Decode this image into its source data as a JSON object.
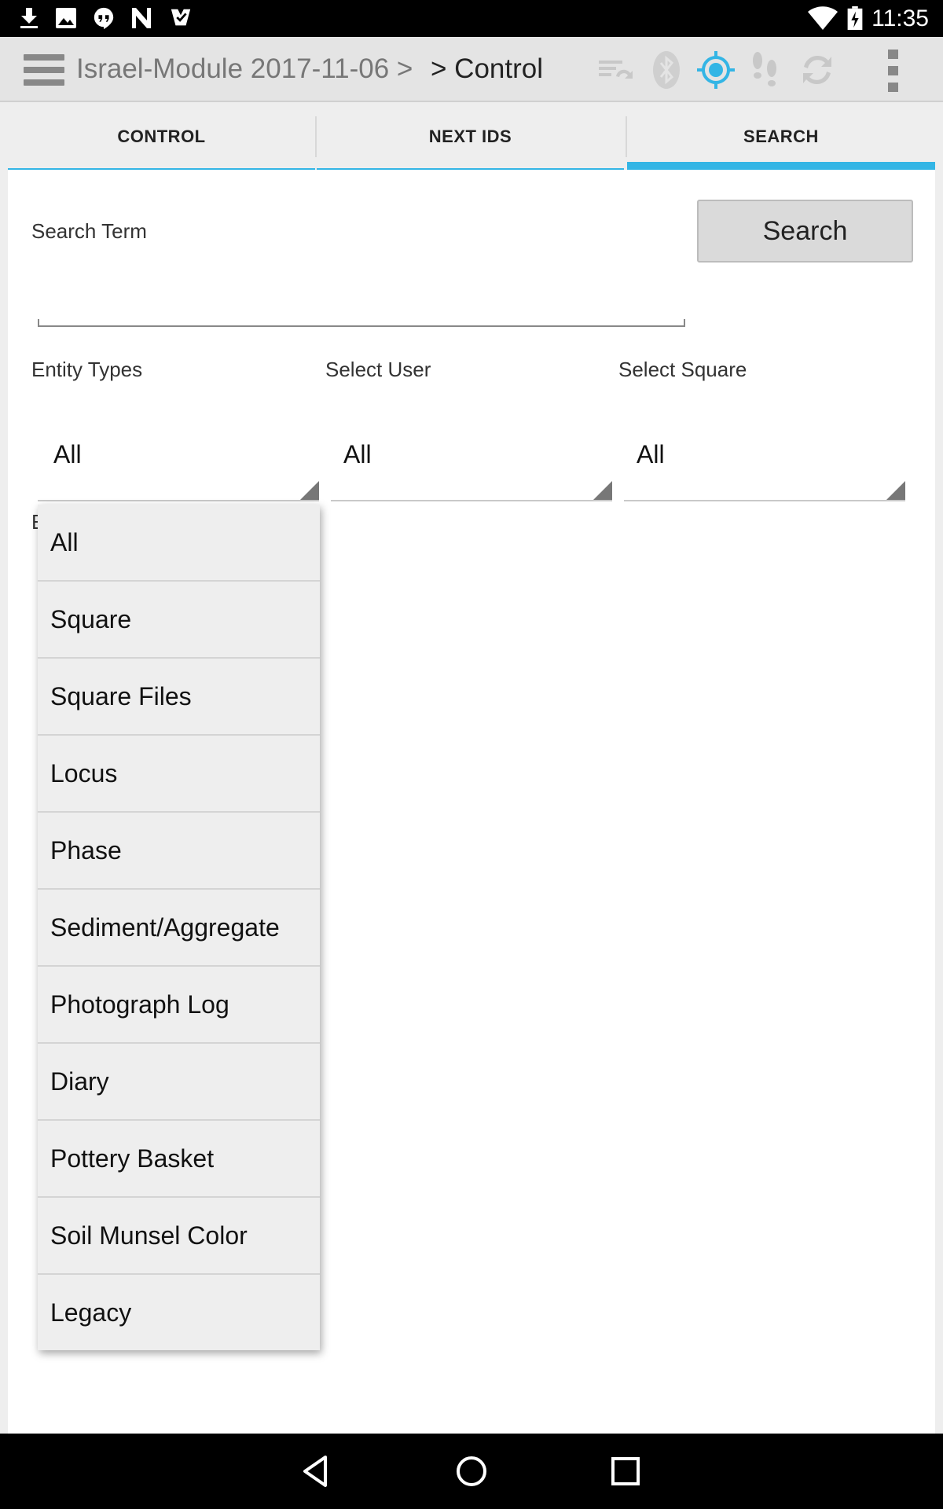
{
  "status_bar": {
    "time": "11:35",
    "icons": [
      "download-icon",
      "image-icon",
      "hangouts-icon",
      "nfc-icon",
      "inbox-check-icon",
      "wifi-icon",
      "battery-charging-icon"
    ]
  },
  "action_bar": {
    "breadcrumb_project": "Israel-Module 2017-11-06 >",
    "breadcrumb_current": "> Control",
    "icons": [
      "sync-list-icon",
      "bluetooth-icon",
      "gps-target-icon",
      "footsteps-icon",
      "refresh-icon",
      "overflow-menu-icon"
    ],
    "accent_color": "#33b5e5"
  },
  "tabs": [
    {
      "label": "CONTROL",
      "selected": false
    },
    {
      "label": "NEXT IDS",
      "selected": false
    },
    {
      "label": "SEARCH",
      "selected": true
    }
  ],
  "search": {
    "term_label": "Search Term",
    "term_value": "",
    "button_label": "Search"
  },
  "filters": {
    "entity_types": {
      "label": "Entity Types",
      "value": "All"
    },
    "select_user": {
      "label": "Select User",
      "value": "All"
    },
    "select_square": {
      "label": "Select Square",
      "value": "All"
    }
  },
  "hidden_label_fragment": "E",
  "dropdown": {
    "items": [
      "All",
      "Square",
      "Square Files",
      "Locus",
      "Phase",
      "Sediment/Aggregate",
      "Photograph Log",
      "Diary",
      "Pottery Basket",
      "Soil Munsel Color",
      "Legacy"
    ]
  },
  "nav_bar": {
    "icons": [
      "back-icon",
      "home-icon",
      "recents-icon"
    ]
  }
}
